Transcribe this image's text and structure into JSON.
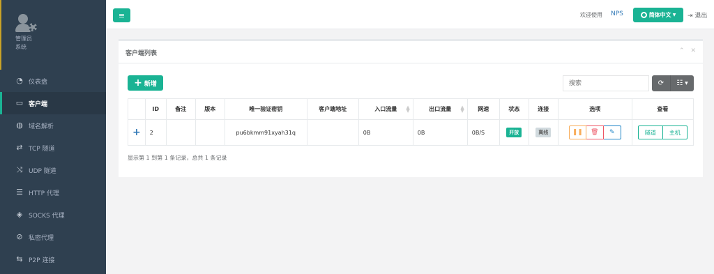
{
  "sidebar": {
    "profile_line1": "管理员",
    "profile_line2": "系统",
    "items": [
      {
        "label": "仪表盘",
        "icon": "dashboard-icon"
      },
      {
        "label": "客户端",
        "icon": "monitor-icon",
        "active": true
      },
      {
        "label": "域名解析",
        "icon": "globe-icon"
      },
      {
        "label": "TCP 隧道",
        "icon": "retweet-icon"
      },
      {
        "label": "UDP 隧道",
        "icon": "random-icon"
      },
      {
        "label": "HTTP 代理",
        "icon": "server-icon"
      },
      {
        "label": "SOCKS 代理",
        "icon": "layers-icon"
      },
      {
        "label": "私密代理",
        "icon": "eye-slash-icon"
      },
      {
        "label": "P2P 连接",
        "icon": "exchange-icon"
      }
    ]
  },
  "topbar": {
    "welcome": "欢迎使用",
    "brand": "NPS",
    "language": "简体中文",
    "logout": "退出"
  },
  "panel": {
    "title": "客户端列表",
    "add_label": "新增",
    "search_placeholder": "搜索",
    "columns": [
      "ID",
      "备注",
      "版本",
      "唯一验证密钥",
      "客户端地址",
      "入口流量",
      "出口流量",
      "网速",
      "状态",
      "连接",
      "选项",
      "查看"
    ],
    "rows": [
      {
        "id": "2",
        "remark": "",
        "version": "",
        "vkey": "pu6bkmm91xyah31q",
        "addr": "",
        "in_flow": "0B",
        "out_flow": "0B",
        "rate": "0B/S",
        "status": "开放",
        "connect": "离线",
        "view_tunnel": "隧道",
        "view_host": "主机"
      }
    ],
    "footer": "显示第 1 到第 1 条记录，总共 1 条记录"
  },
  "colors": {
    "sidebar_bg": "#2f4050",
    "primary": "#1ab394",
    "link": "#337ab7",
    "warning": "#f8ac59",
    "danger": "#ed5565",
    "info": "#1c84c6"
  }
}
